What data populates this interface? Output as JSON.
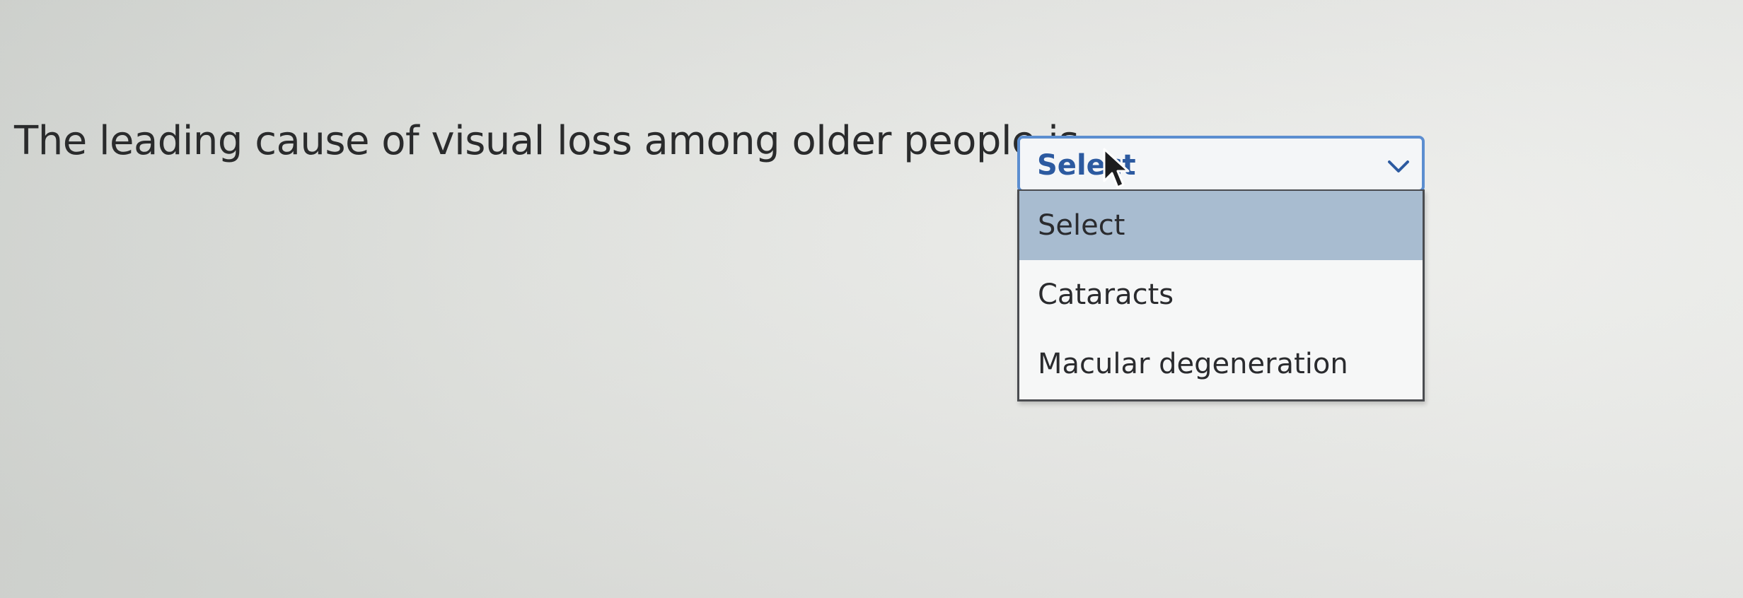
{
  "question": {
    "text": "The leading cause of visual loss among older people is"
  },
  "dropdown": {
    "selected_value": "Select",
    "options": [
      {
        "label": "Select",
        "highlighted": true
      },
      {
        "label": "Cataracts",
        "highlighted": false
      },
      {
        "label": "Macular degeneration",
        "highlighted": false
      }
    ],
    "chevron_icon": "chevron-down-icon",
    "cursor_icon": "mouse-pointer-icon"
  },
  "colors": {
    "select_border": "#5c8ed0",
    "select_text": "#2c5aa0",
    "highlight": "#a8bcd0"
  }
}
